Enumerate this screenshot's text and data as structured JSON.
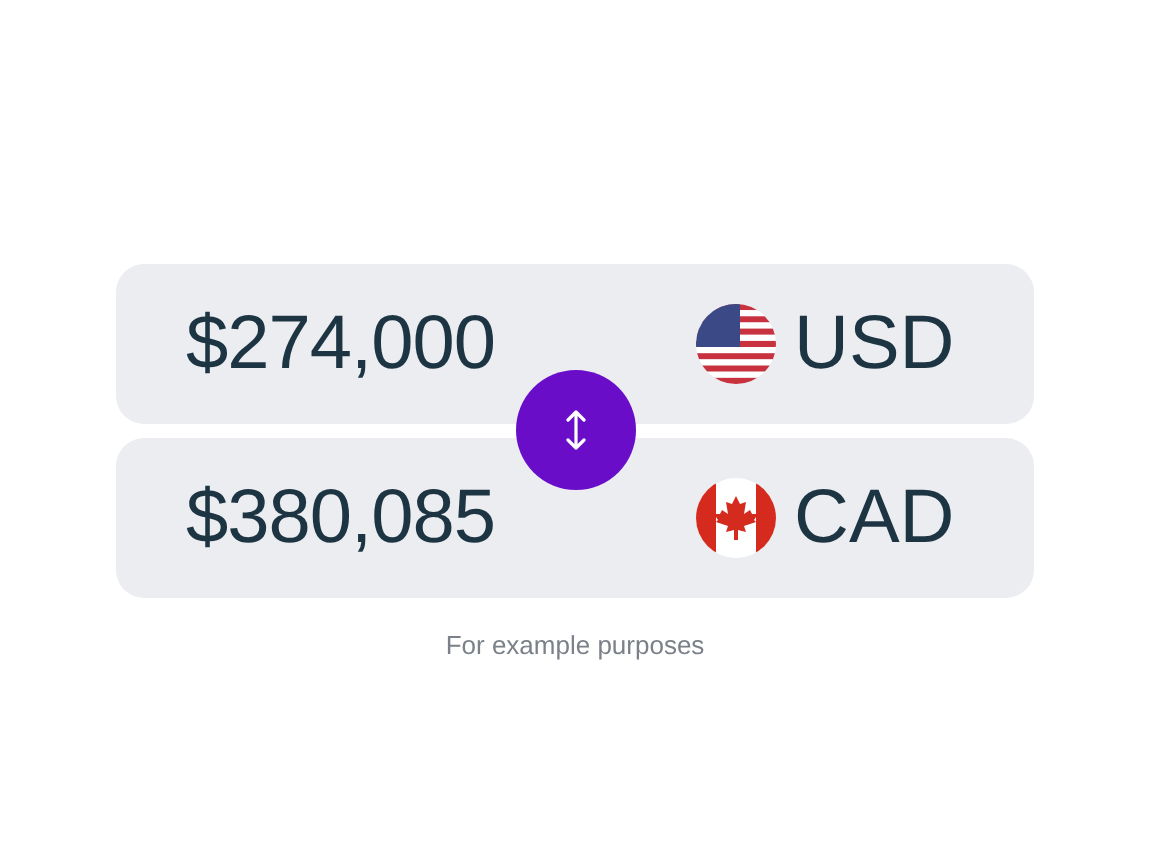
{
  "rows": [
    {
      "amount": "$274,000",
      "currency": "USD"
    },
    {
      "amount": "$380,085",
      "currency": "CAD"
    }
  ],
  "caption": "For example purposes"
}
